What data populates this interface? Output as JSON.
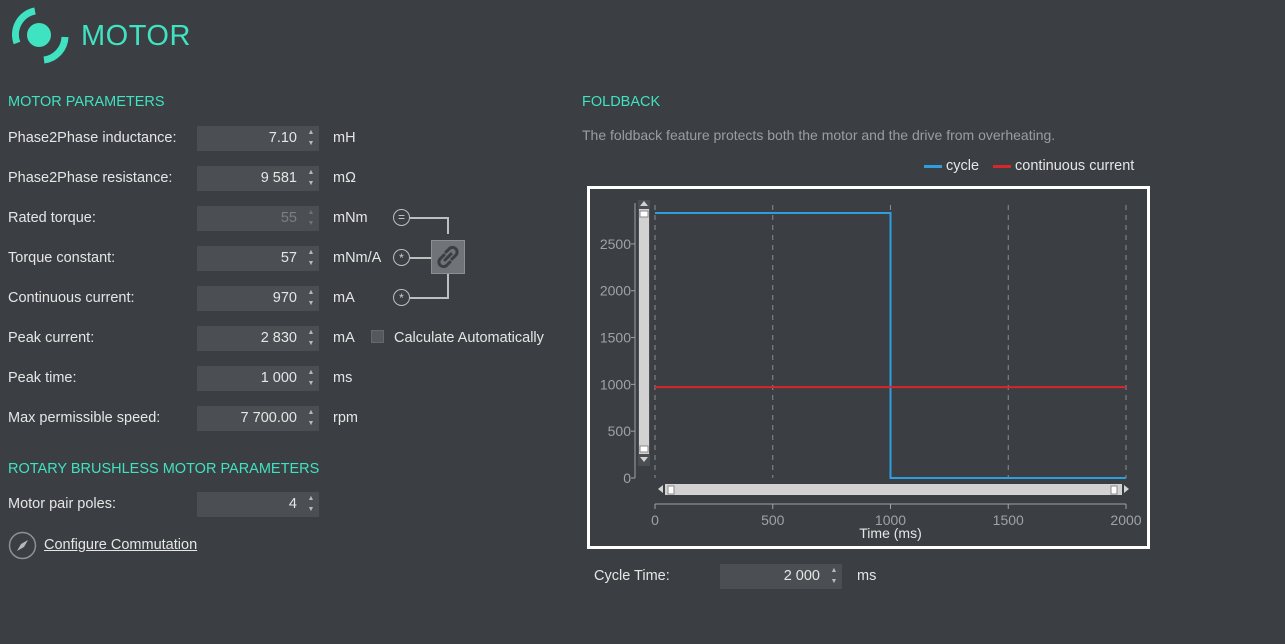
{
  "app": {
    "title": "MOTOR"
  },
  "motor_params": {
    "heading": "MOTOR PARAMETERS",
    "rows": [
      {
        "label": "Phase2Phase inductance:",
        "value": "7.10",
        "unit": "mH"
      },
      {
        "label": "Phase2Phase resistance:",
        "value": "9 581",
        "unit": "mΩ"
      },
      {
        "label": "Rated torque:",
        "value": "55",
        "unit": "mNm"
      },
      {
        "label": "Torque constant:",
        "value": "57",
        "unit": "mNm/A"
      },
      {
        "label": "Continuous current:",
        "value": "970",
        "unit": "mA"
      },
      {
        "label": "Peak current:",
        "value": "2 830",
        "unit": "mA"
      },
      {
        "label": "Peak time:",
        "value": "1 000",
        "unit": "ms"
      },
      {
        "label": "Max permissible speed:",
        "value": "7 700.00",
        "unit": "rpm"
      }
    ],
    "calc_auto_label": "Calculate Automatically",
    "calc_auto_checked": false,
    "formula_symbols": [
      "=",
      "*",
      "*"
    ]
  },
  "rotary": {
    "heading": "ROTARY BRUSHLESS MOTOR PARAMETERS",
    "pair_poles_label": "Motor pair poles:",
    "pair_poles_value": "4",
    "configure_label": "Configure Commutation"
  },
  "foldback": {
    "heading": "FOLDBACK",
    "description": "The foldback feature protects both the motor and the drive from overheating.",
    "cycle_time_label": "Cycle Time:",
    "cycle_time_value": "2 000",
    "cycle_time_unit": "ms"
  },
  "colors": {
    "accent": "#3fe3c2",
    "cycle": "#2d9fe0",
    "continuous": "#d9262a"
  },
  "chart_data": {
    "type": "line",
    "xlabel": "Time (ms)",
    "ylabel": "",
    "xlim": [
      0,
      2000
    ],
    "ylim": [
      0,
      2830
    ],
    "xticks": [
      0,
      500,
      1000,
      1500,
      2000
    ],
    "yticks": [
      0,
      500,
      1000,
      1500,
      2000,
      2500
    ],
    "grid": "vertical-dashed",
    "legend": "top-right",
    "series": [
      {
        "name": "cycle",
        "color": "#2d9fe0",
        "x": [
          0,
          1000,
          1000,
          2000
        ],
        "y": [
          2830,
          2830,
          0,
          0
        ]
      },
      {
        "name": "continuous current",
        "color": "#d9262a",
        "x": [
          0,
          2000
        ],
        "y": [
          970,
          970
        ]
      }
    ]
  }
}
